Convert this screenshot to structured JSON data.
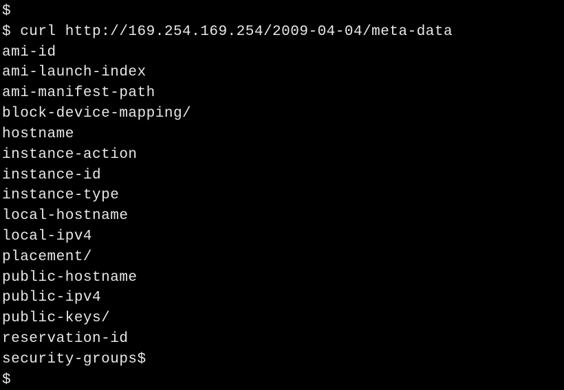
{
  "prompt_symbol": "$",
  "command_line": "$ curl http://169.254.169.254/2009-04-04/meta-data",
  "output_lines": [
    "ami-id",
    "ami-launch-index",
    "ami-manifest-path",
    "block-device-mapping/",
    "hostname",
    "instance-action",
    "instance-id",
    "instance-type",
    "local-hostname",
    "local-ipv4",
    "placement/",
    "public-hostname",
    "public-ipv4",
    "public-keys/",
    "reservation-id"
  ],
  "final_line": "security-groups$",
  "trailing_prompt": "$"
}
